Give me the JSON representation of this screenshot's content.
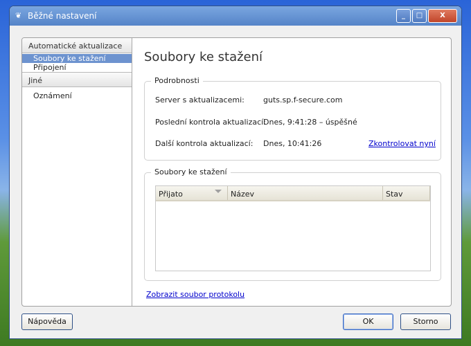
{
  "window": {
    "title": "Běžné nastavení",
    "minimize": "_",
    "maximize": "□",
    "close": "X"
  },
  "sidebar": {
    "groups": [
      {
        "header": "Automatické aktualizace",
        "items": [
          "Soubory ke stažení",
          "Připojení"
        ]
      },
      {
        "header": "Jiné",
        "items": [
          "Oznámení"
        ]
      }
    ]
  },
  "main": {
    "title": "Soubory ke stažení",
    "details": {
      "legend": "Podrobnosti",
      "rows": [
        {
          "label": "Server s aktualizacemi:",
          "value": "guts.sp.f-secure.com"
        },
        {
          "label": "Poslední kontrola aktualizací:",
          "value": "Dnes, 9:41:28 – úspěšné"
        },
        {
          "label": "Další kontrola aktualizací:",
          "value": "Dnes, 10:41:26"
        }
      ],
      "check_now": "Zkontrolovat nyní"
    },
    "downloads": {
      "legend": "Soubory ke stažení",
      "columns": [
        "Přijato",
        "Název",
        "Stav"
      ]
    },
    "log_link": "Zobrazit soubor protokolu"
  },
  "buttons": {
    "help": "Nápověda",
    "ok": "OK",
    "cancel": "Storno"
  }
}
